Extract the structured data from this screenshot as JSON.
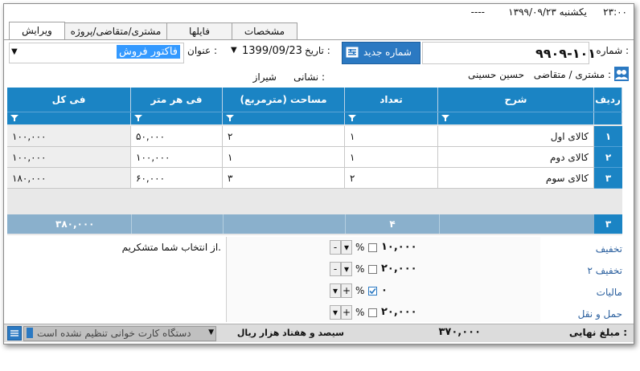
{
  "top_bar": {
    "time": "۲۳:۰۰",
    "date": "یکشنبه ۱۳۹۹/۰۹/۲۳",
    "dashes": "----"
  },
  "tabs": [
    {
      "label": "ویرایش",
      "active": true
    },
    {
      "label": "مشتری/متقاضی/پروژه",
      "active": false
    },
    {
      "label": "فایلها",
      "active": false
    },
    {
      "label": "مشخصات",
      "active": false
    }
  ],
  "header": {
    "number_label": "شماره :",
    "number_value": "۹۹۰۹-۱۰۱",
    "new_number_button": "شماره جدید",
    "date_label": "تاریخ :",
    "date_value": "1399/09/23",
    "title_label": "عنوان :",
    "title_value": "فاکتور فروش",
    "customer_label": "مشتری / متقاضی :",
    "customer_value": "حسین حسینی",
    "address_label": "نشانی :",
    "address_value": "شیراز"
  },
  "grid": {
    "columns": [
      "ردیف",
      "شرح",
      "تعداد",
      "مساحت (مترمربع)",
      "فی هر متر",
      "فی کل"
    ],
    "rows": [
      {
        "num": "۱",
        "desc": "کالای اول",
        "qty": "۱",
        "area": "۲",
        "unit": "۵۰,۰۰۰",
        "total": "۱۰۰,۰۰۰"
      },
      {
        "num": "۲",
        "desc": "کالای دوم",
        "qty": "۱",
        "area": "۱",
        "unit": "۱۰۰,۰۰۰",
        "total": "۱۰۰,۰۰۰"
      },
      {
        "num": "۳",
        "desc": "کالای سوم",
        "qty": "۲",
        "area": "۳",
        "unit": "۶۰,۰۰۰",
        "total": "۱۸۰,۰۰۰"
      }
    ],
    "footer": {
      "count": "۳",
      "qty_sum": "۴",
      "total_sum": "۳۸۰,۰۰۰"
    }
  },
  "adjustments": [
    {
      "label": "تخفیف",
      "value": "۱۰,۰۰۰",
      "checked": false,
      "sign": "-"
    },
    {
      "label": "تخفیف ۲",
      "value": "۲۰,۰۰۰",
      "checked": false,
      "sign": "-"
    },
    {
      "label": "مالیات",
      "value": "۰",
      "checked": true,
      "sign": "+"
    },
    {
      "label": "حمل و نقل",
      "value": "۲۰,۰۰۰",
      "checked": false,
      "sign": "+"
    }
  ],
  "percent_symbol": "%",
  "notes": "از انتخاب شما متشکریم.",
  "final": {
    "label": "مبلغ نهایی :",
    "amount": "۳۷۰,۰۰۰",
    "in_words": "سیصد و هفتاد هزار ریال"
  },
  "card_reader_status": "دستگاه کارت خوانی تنظیم نشده است",
  "colors": {
    "header_blue": "#1b84c4",
    "link_blue": "#2a5f9e",
    "button_blue": "#2b79c2"
  }
}
